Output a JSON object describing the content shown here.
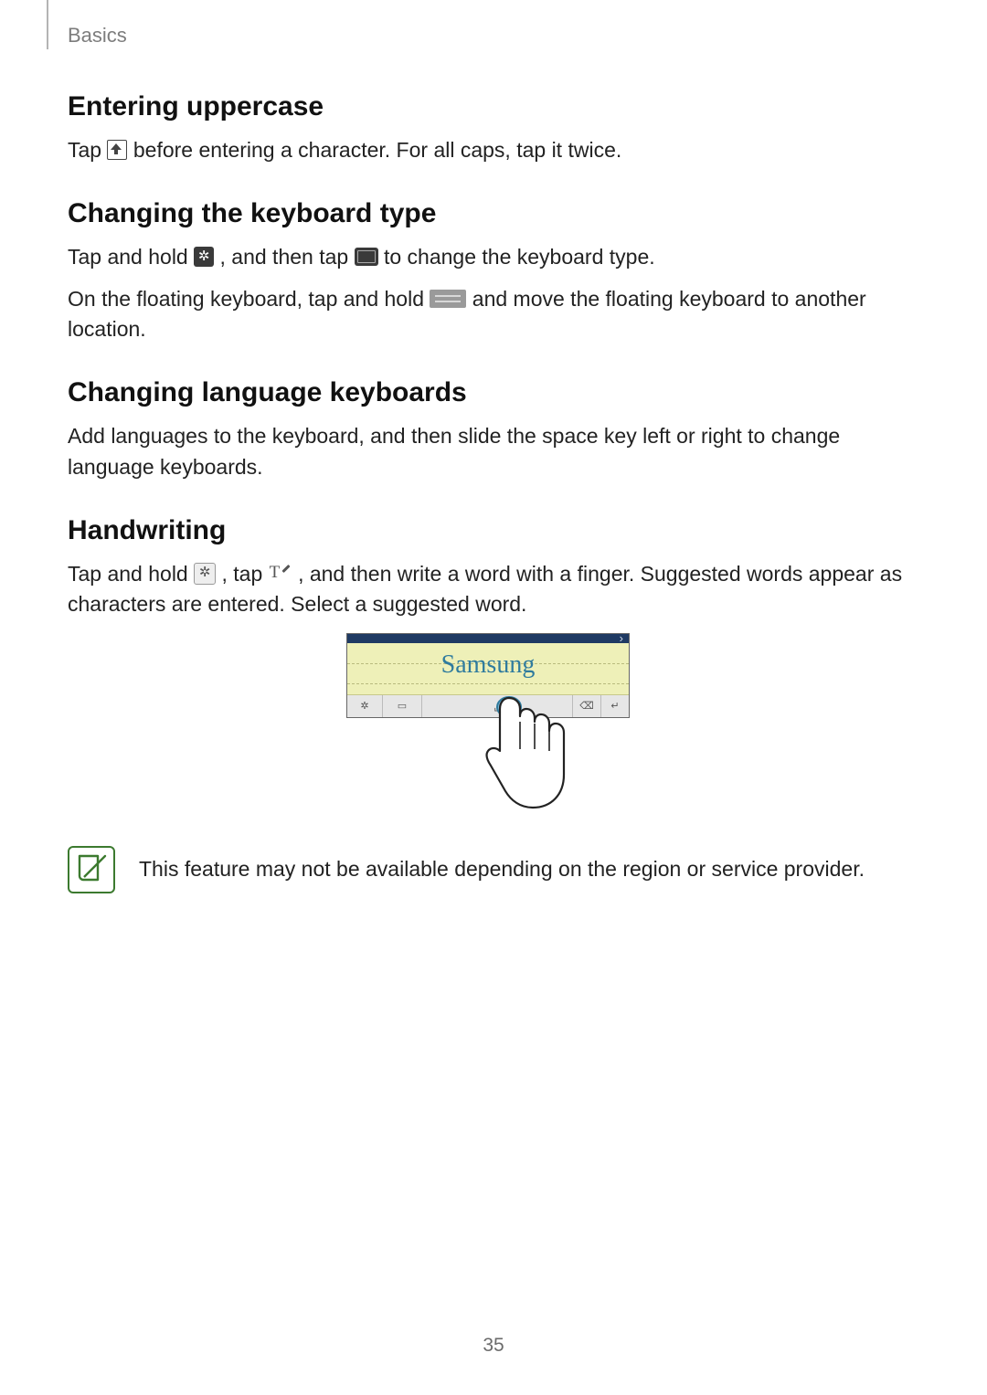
{
  "header": {
    "section_label": "Basics"
  },
  "page_number": "35",
  "sections": {
    "uppercase": {
      "heading": "Entering uppercase",
      "p1a": "Tap ",
      "p1b": " before entering a character. For all caps, tap it twice."
    },
    "kbtype": {
      "heading": "Changing the keyboard type",
      "p1a": "Tap and hold ",
      "p1b": ", and then tap ",
      "p1c": " to change the keyboard type.",
      "p2a": "On the floating keyboard, tap and hold ",
      "p2b": " and move the floating keyboard to another location."
    },
    "lang": {
      "heading": "Changing language keyboards",
      "p1": "Add languages to the keyboard, and then slide the space key left or right to change language keyboards."
    },
    "handwriting": {
      "heading": "Handwriting",
      "p1a": "Tap and hold ",
      "p1b": ", tap ",
      "p1c": ", and then write a word with a finger. Suggested words appear as characters are entered. Select a suggested word.",
      "illustration_word": "Samsung"
    }
  },
  "note": {
    "text": "This feature may not be available depending on the region or service provider."
  }
}
